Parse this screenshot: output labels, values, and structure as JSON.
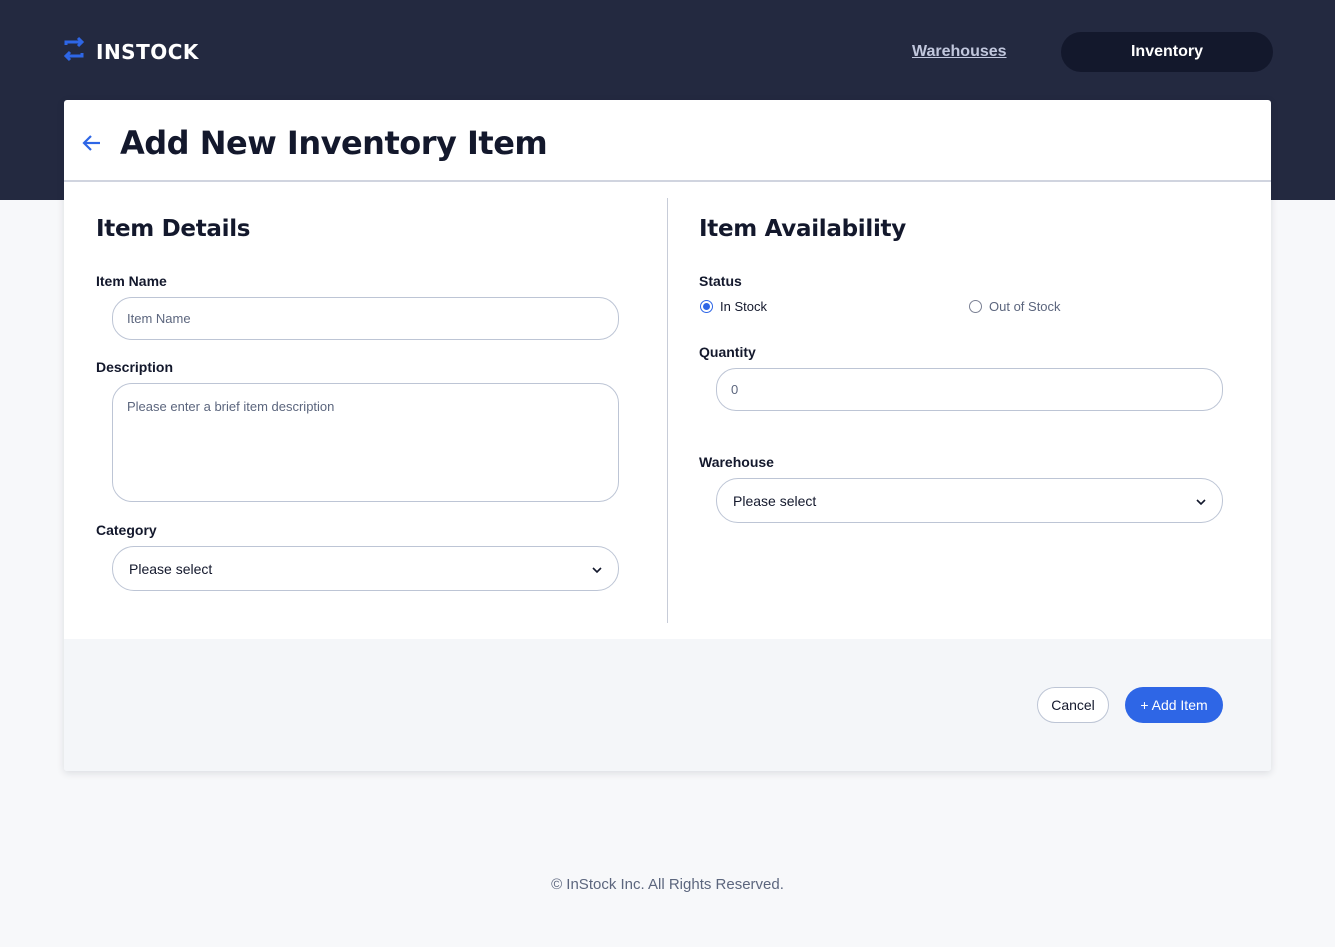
{
  "header": {
    "logo_text": "INSTOCK",
    "nav": {
      "warehouses_label": "Warehouses",
      "inventory_label": "Inventory"
    }
  },
  "page": {
    "title": "Add New Inventory Item"
  },
  "item_details": {
    "title": "Item Details",
    "item_name_label": "Item Name",
    "item_name_placeholder": "Item Name",
    "description_label": "Description",
    "description_placeholder": "Please enter a brief item description",
    "category_label": "Category",
    "category_value": "Please select"
  },
  "item_availability": {
    "title": "Item Availability",
    "status_label": "Status",
    "status_options": [
      "In Stock",
      "Out of Stock"
    ],
    "status_selected": "In Stock",
    "quantity_label": "Quantity",
    "quantity_value": "0",
    "warehouse_label": "Warehouse",
    "warehouse_value": "Please select"
  },
  "actions": {
    "cancel_label": "Cancel",
    "add_label": "+ Add Item"
  },
  "footer": {
    "copyright": "© InStock Inc. All Rights Reserved."
  },
  "colors": {
    "header_bg": "#232940",
    "accent": "#2e66e6",
    "text": "#13182c"
  }
}
